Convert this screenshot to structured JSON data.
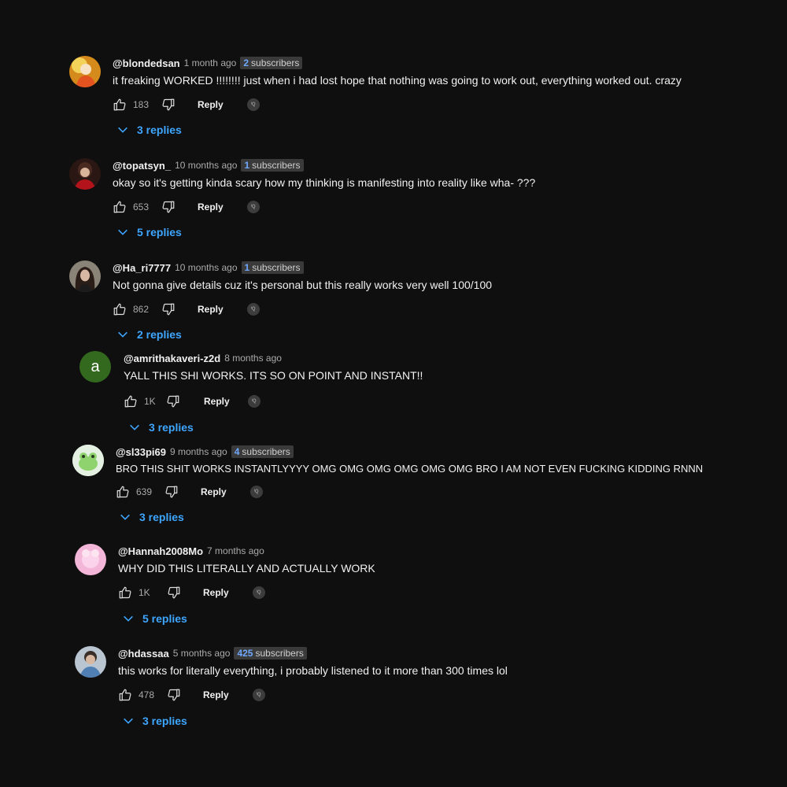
{
  "action_labels": {
    "reply": "Reply",
    "badge": "ᴵQ"
  },
  "colors": {
    "background": "#0f0f0f",
    "link": "#3ea6ff",
    "subscriber_number": "#6ea8ff"
  },
  "comments": [
    {
      "author": "@blondedsan",
      "time": "1 month ago",
      "subscriber_count": "2",
      "subscriber_label": "subscribers",
      "text": "it freaking WORKED !!!!!!!! just when i had lost hope that nothing was going to work out, everything worked out. crazy",
      "likes": "183",
      "replies": "3 replies",
      "avatar_icon": "yellow-portrait-avatar"
    },
    {
      "author": "@topatsyn_",
      "time": "10 months ago",
      "subscriber_count": "1",
      "subscriber_label": "subscribers",
      "text": "okay so it's getting kinda scary how my thinking is manifesting into reality like wha- ???",
      "likes": "653",
      "replies": "5 replies",
      "avatar_icon": "red-portrait-avatar"
    },
    {
      "author": "@Ha_ri7777",
      "time": "10 months ago",
      "subscriber_count": "1",
      "subscriber_label": "subscribers",
      "text": "Not gonna give details cuz it's personal but this really works very well 100/100",
      "likes": "862",
      "replies": "2 replies",
      "avatar_icon": "dark-portrait-avatar"
    },
    {
      "author": "@amrithakaveri-z2d",
      "time": "8 months ago",
      "subscriber_count": "",
      "subscriber_label": "",
      "text": "YALL THIS SHI WORKS. ITS SO ON POINT AND INSTANT!!",
      "likes": "1K",
      "replies": "3 replies",
      "avatar_letter": "a",
      "avatar_icon": "letter-avatar"
    },
    {
      "author": "@sl33pi69",
      "time": "9 months ago",
      "subscriber_count": "4",
      "subscriber_label": "subscribers",
      "text": "BRO THIS SHIT WORKS INSTANTLYYYY OMG OMG OMG OMG OMG OMG BRO I AM NOT EVEN FUCKING KIDDING RNNN",
      "likes": "639",
      "replies": "3 replies",
      "avatar_icon": "frog-avatar"
    },
    {
      "author": "@Hannah2008Mo",
      "time": "7 months ago",
      "subscriber_count": "",
      "subscriber_label": "",
      "text": "WHY DID THIS LITERALLY AND ACTUALLY WORK",
      "likes": "1K",
      "replies": "5 replies",
      "avatar_icon": "pink-avatar"
    },
    {
      "author": "@hdassaa",
      "time": "5 months ago",
      "subscriber_count": "425",
      "subscriber_label": "subscribers",
      "text": "this works for literally everything, i probably listened to it more than 300 times lol",
      "likes": "478",
      "replies": "3 replies",
      "avatar_icon": "blue-portrait-avatar"
    }
  ]
}
